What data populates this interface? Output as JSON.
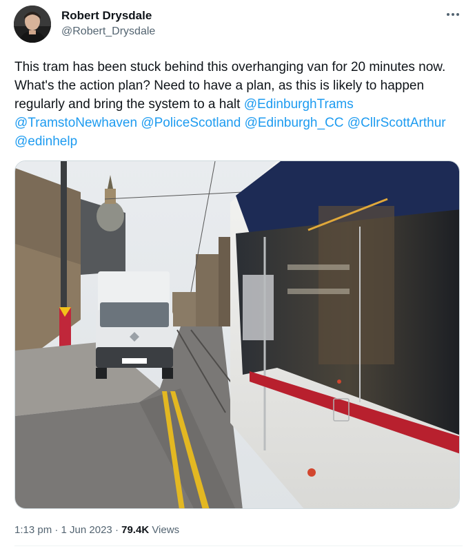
{
  "author": {
    "name": "Robert Drysdale",
    "handle": "@Robert_Drysdale"
  },
  "tweet": {
    "text_parts": {
      "t1": "This tram has been stuck behind this overhanging van for 20 minutes now. What's the action plan? Need to have a plan, as this is likely to happen regularly and bring the system to a halt ",
      "m1": "@EdinburghTrams",
      "m2": "@TramstoNewhaven",
      "m3": "@PoliceScotland",
      "m4": "@Edinburgh_CC",
      "m5": "@CllrScottArthur",
      "m6": "@edinhelp"
    },
    "mention_color": "#1d9bf0"
  },
  "meta": {
    "time": "1:13 pm",
    "sep1": "·",
    "date": "1 Jun 2023",
    "sep2": "·",
    "views_count": "79.4K",
    "views_label": "Views"
  },
  "icons": {
    "more": "more-horizontal-icon"
  },
  "colors": {
    "text": "#0f1419",
    "secondary": "#536471",
    "link": "#1d9bf0",
    "tram_red": "#b8202e"
  }
}
